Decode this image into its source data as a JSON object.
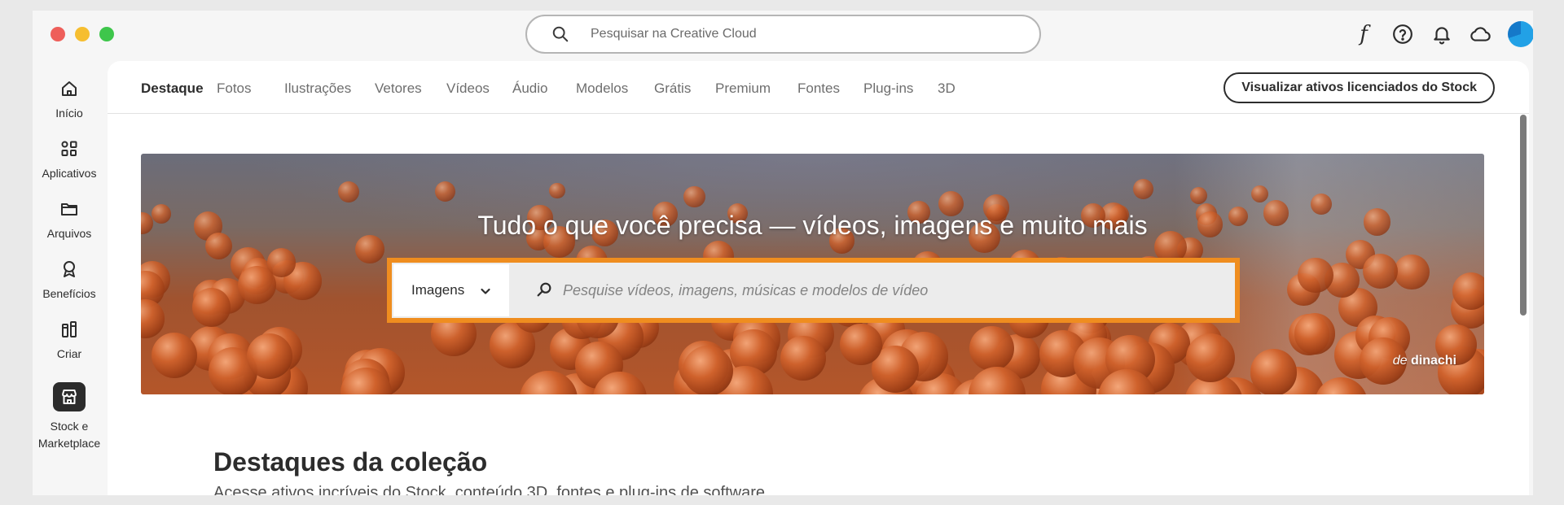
{
  "window": {
    "controls": [
      "close",
      "minimize",
      "maximize"
    ],
    "search_placeholder": "Pesquisar na Creative Cloud"
  },
  "topbar": {
    "icons": [
      "fonts-icon",
      "help-icon",
      "bell-icon",
      "cloud-icon",
      "avatar"
    ],
    "fonts_glyph": "f"
  },
  "sidebar": {
    "items": [
      {
        "label": "Início",
        "icon": "home-icon"
      },
      {
        "label": "Aplicativos",
        "icon": "apps-icon"
      },
      {
        "label": "Arquivos",
        "icon": "folder-icon"
      },
      {
        "label": "Benefícios",
        "icon": "award-icon"
      },
      {
        "label": "Criar",
        "icon": "create-icon"
      },
      {
        "label": "Stock e Marketplace",
        "icon": "store-icon",
        "active": true
      }
    ]
  },
  "tabs": [
    {
      "label": "Destaque",
      "active": true
    },
    {
      "label": "Fotos"
    },
    {
      "label": "Ilustrações"
    },
    {
      "label": "Vetores"
    },
    {
      "label": "Vídeos"
    },
    {
      "label": "Áudio"
    },
    {
      "label": "Modelos"
    },
    {
      "label": "Grátis"
    },
    {
      "label": "Premium"
    },
    {
      "label": "Fontes"
    },
    {
      "label": "Plug-ins"
    },
    {
      "label": "3D"
    }
  ],
  "licensed_button": "Visualizar ativos licenciados do Stock",
  "hero": {
    "title": "Tudo o que você precisa — vídeos, imagens e muito mais",
    "filter": "Imagens",
    "search_placeholder": "Pesquise vídeos, imagens, músicas e modelos de vídeo",
    "credit_prefix": "de",
    "credit_author": "dinachi",
    "accent_color": "#ef8d1f"
  },
  "section": {
    "title": "Destaques da coleção",
    "subtitle": "Acesse ativos incríveis do Stock, conteúdo 3D, fontes e plug-ins de software"
  }
}
